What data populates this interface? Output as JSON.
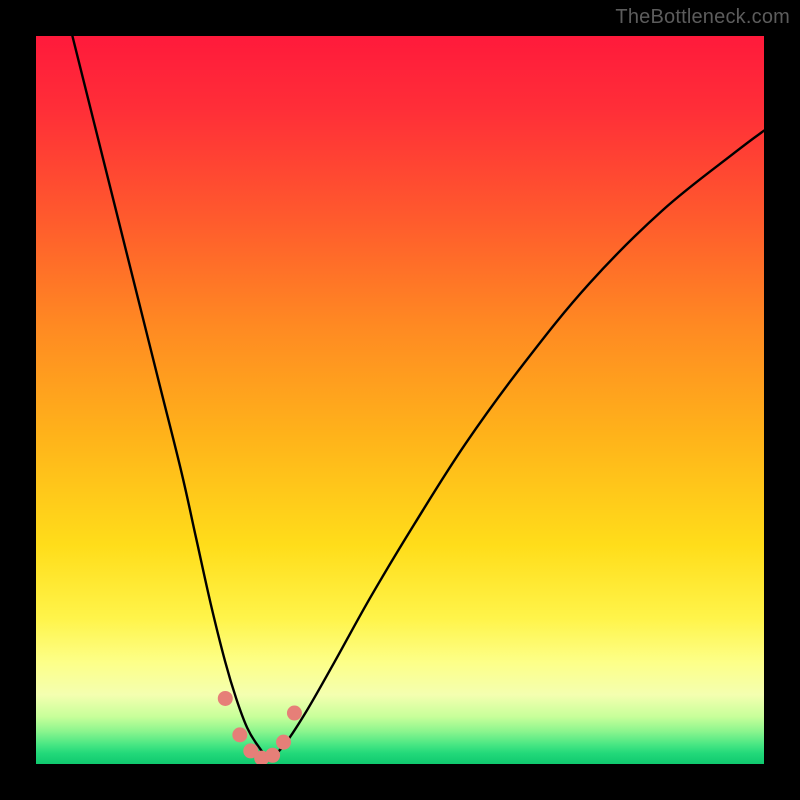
{
  "watermark": "TheBottleneck.com",
  "colors": {
    "frame": "#000000",
    "curve": "#000000",
    "marker_fill": "#e67f78",
    "gradient_stops": [
      {
        "offset": 0.0,
        "color": "#ff1a3b"
      },
      {
        "offset": 0.1,
        "color": "#ff2e38"
      },
      {
        "offset": 0.25,
        "color": "#ff5a2d"
      },
      {
        "offset": 0.4,
        "color": "#ff8a22"
      },
      {
        "offset": 0.55,
        "color": "#ffb31a"
      },
      {
        "offset": 0.7,
        "color": "#ffdd1a"
      },
      {
        "offset": 0.8,
        "color": "#fff44a"
      },
      {
        "offset": 0.86,
        "color": "#fdff88"
      },
      {
        "offset": 0.905,
        "color": "#f4ffb0"
      },
      {
        "offset": 0.935,
        "color": "#c8ff9a"
      },
      {
        "offset": 0.955,
        "color": "#8cf58e"
      },
      {
        "offset": 0.972,
        "color": "#4de884"
      },
      {
        "offset": 0.985,
        "color": "#23d97a"
      },
      {
        "offset": 1.0,
        "color": "#0fc96f"
      }
    ]
  },
  "chart_data": {
    "type": "line",
    "title": "",
    "xlabel": "",
    "ylabel": "",
    "xlim": [
      0,
      100
    ],
    "ylim": [
      0,
      100
    ],
    "note": "V-shaped bottleneck curve; y reads as mismatch percentage (0 at minimum). x is a normalized hardware-balance axis. Values estimated from pixel positions.",
    "series": [
      {
        "name": "bottleneck-curve",
        "x": [
          5,
          8,
          11,
          14,
          17,
          20,
          22,
          24,
          26,
          27.5,
          29,
          30.5,
          32,
          34,
          37,
          41,
          46,
          52,
          59,
          67,
          76,
          86,
          96,
          100
        ],
        "y": [
          100,
          88,
          76,
          64,
          52,
          40,
          31,
          22,
          14,
          9,
          5,
          2.5,
          1.0,
          2.5,
          7,
          14,
          23,
          33,
          44,
          55,
          66,
          76,
          84,
          87
        ]
      }
    ],
    "markers": {
      "name": "highlighted-points",
      "x": [
        26.0,
        28.0,
        29.5,
        31.0,
        32.5,
        34.0,
        35.5
      ],
      "y": [
        9.0,
        4.0,
        1.8,
        0.8,
        1.2,
        3.0,
        7.0
      ]
    }
  }
}
